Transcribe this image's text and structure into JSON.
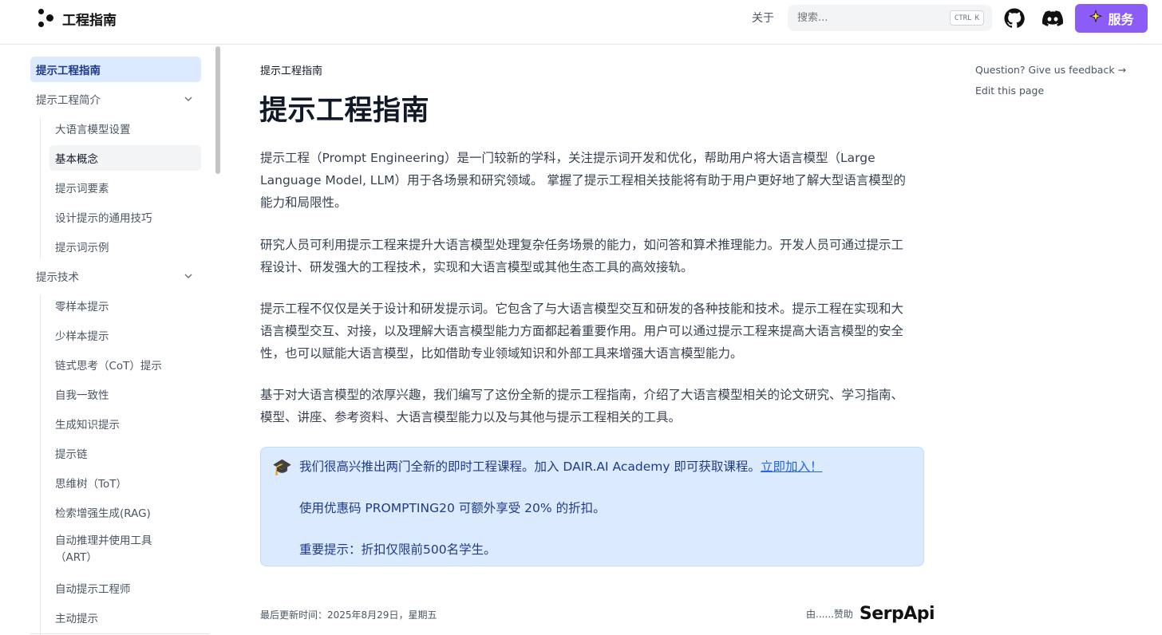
{
  "header": {
    "logo_text": "工程指南",
    "nav_about": "关于",
    "search_placeholder": "搜索...",
    "search_kbd_ctrl": "CTRL",
    "search_kbd_key": "K",
    "services_label": "服务",
    "services_color": "#8b5cf6"
  },
  "sidebar": {
    "items": [
      {
        "label": "提示工程指南",
        "state": "active"
      },
      {
        "label": "提示工程简介",
        "expandable": true
      },
      {
        "label": "大语言模型设置"
      },
      {
        "label": "基本概念",
        "state": "selected"
      },
      {
        "label": "提示词要素"
      },
      {
        "label": "设计提示的通用技巧"
      },
      {
        "label": "提示词示例"
      },
      {
        "label": "提示技术",
        "expandable": true
      },
      {
        "label": "零样本提示"
      },
      {
        "label": "少样本提示"
      },
      {
        "label": "链式思考（CoT）提示"
      },
      {
        "label": "自我一致性"
      },
      {
        "label": "生成知识提示"
      },
      {
        "label": "提示链"
      },
      {
        "label": "思维树（ToT）"
      },
      {
        "label": "检索增强生成(RAG)"
      },
      {
        "label": "自动推理并使用工具"
      },
      {
        "label": "（ART）"
      },
      {
        "label": "自动提示工程师"
      },
      {
        "label": "主动提示"
      }
    ]
  },
  "main": {
    "breadcrumb": "提示工程指南",
    "title": "提示工程指南",
    "paragraphs": [
      [
        "提示工程（Prompt Engineering）是一门较新的学科，关注提示词开发和优化，帮助用户将大语言模型（Large",
        "Language Model, LLM）用于各场景和研究领域。 掌握了提示工程相关技能将有助于用户更好地了解大型语言模型的",
        "能力和局限性。"
      ],
      [
        "研究人员可利用提示工程来提升大语言模型处理复杂任务场景的能力，如问答和算术推理能力。开发人员可通过提示工",
        "程设计、研发强大的工程技术，实现和大语言模型或其他生态工具的高效接轨。"
      ],
      [
        "提示工程不仅仅是关于设计和研发提示词。它包含了与大语言模型交互和研发的各种技能和技术。提示工程在实现和大",
        "语言模型交互、对接，以及理解大语言模型能力方面都起着重要作用。用户可以通过提示工程来提高大语言模型的安全",
        "性，也可以赋能大语言模型，比如借助专业领域知识和外部工具来增强大语言模型能力。"
      ],
      [
        "基于对大语言模型的浓厚兴趣，我们编写了这份全新的提示工程指南，介绍了大语言模型相关的论文研究、学习指南、",
        "模型、讲座、参考资料、大语言模型能力以及与其他与提示工程相关的工具。"
      ]
    ],
    "callout": {
      "icon": "🎓",
      "line1": "我们很高兴推出两门全新的即时工程课程。加入 DAIR.AI Academy 即可获取课程。",
      "link": "立即加入！",
      "line2": "使用优惠码 PROMPTING20 可额外享受 20% 的折扣。",
      "line3": "重要提示：折扣仅限前500名学生。"
    },
    "updated": "最后更新时间：2025年8月29日，星期五",
    "sponsor_label": "由......赞助",
    "sponsor_logo": "SerpApi"
  },
  "toc": {
    "feedback": "Question? Give us feedback →",
    "edit": "Edit this page"
  }
}
